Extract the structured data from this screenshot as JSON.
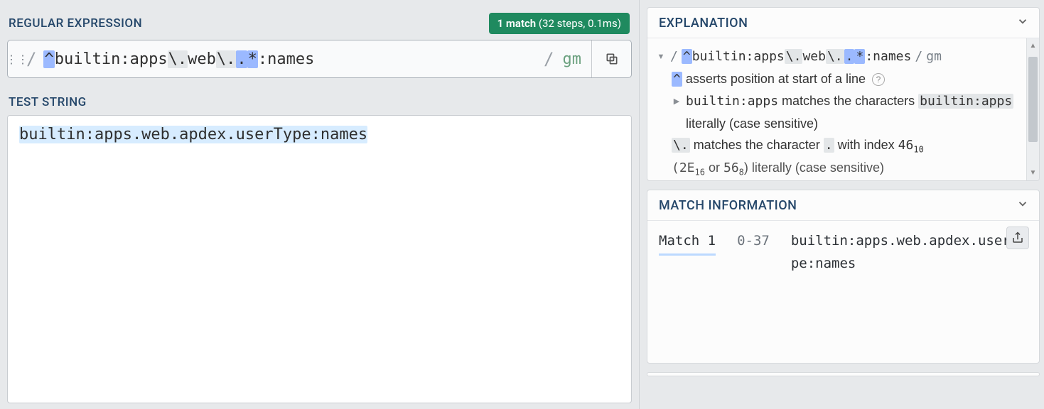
{
  "left": {
    "regex_title": "REGULAR EXPRESSION",
    "match_badge_strong": "1 match",
    "match_badge_rest": " (32 steps, 0.1ms)",
    "slash": "/",
    "flags": "gm",
    "regex_tokens": {
      "anchor": "^",
      "lit1": "builtin:apps",
      "esc1": "\\.",
      "lit2": "web",
      "esc2": "\\.",
      "dot": ".",
      "star": "*",
      "lit3": ":names"
    },
    "teststring_title": "TEST STRING",
    "teststring_value": "builtin:apps.web.apdex.userType:names"
  },
  "explanation": {
    "title": "EXPLANATION",
    "line1_pre_slash": "/",
    "line1_post_slash": "/",
    "line1_flags": "gm",
    "caret": "^",
    "caret_text": " asserts position at start of a line ",
    "lit_token": "builtin:apps",
    "lit_text": " matches the characters ",
    "lit_sample": "builtin:apps",
    "lit_text2": " literally (case sensitive)",
    "esc_token": "\\.",
    "esc_text1": " matches the character ",
    "esc_char": ".",
    "esc_text2": " with index ",
    "esc_dec": "46",
    "esc_dec_base": "10",
    "esc_hex_line": "(2E",
    "esc_hex_base": "16",
    "esc_or": " or ",
    "esc_oct": "56",
    "esc_oct_base": "8",
    "esc_tail": ") literally (case sensitive)"
  },
  "matchinfo": {
    "title": "MATCH INFORMATION",
    "match_label": "Match 1",
    "match_range": "0-37",
    "match_value": "builtin:apps.web.apdex.userType:names"
  }
}
